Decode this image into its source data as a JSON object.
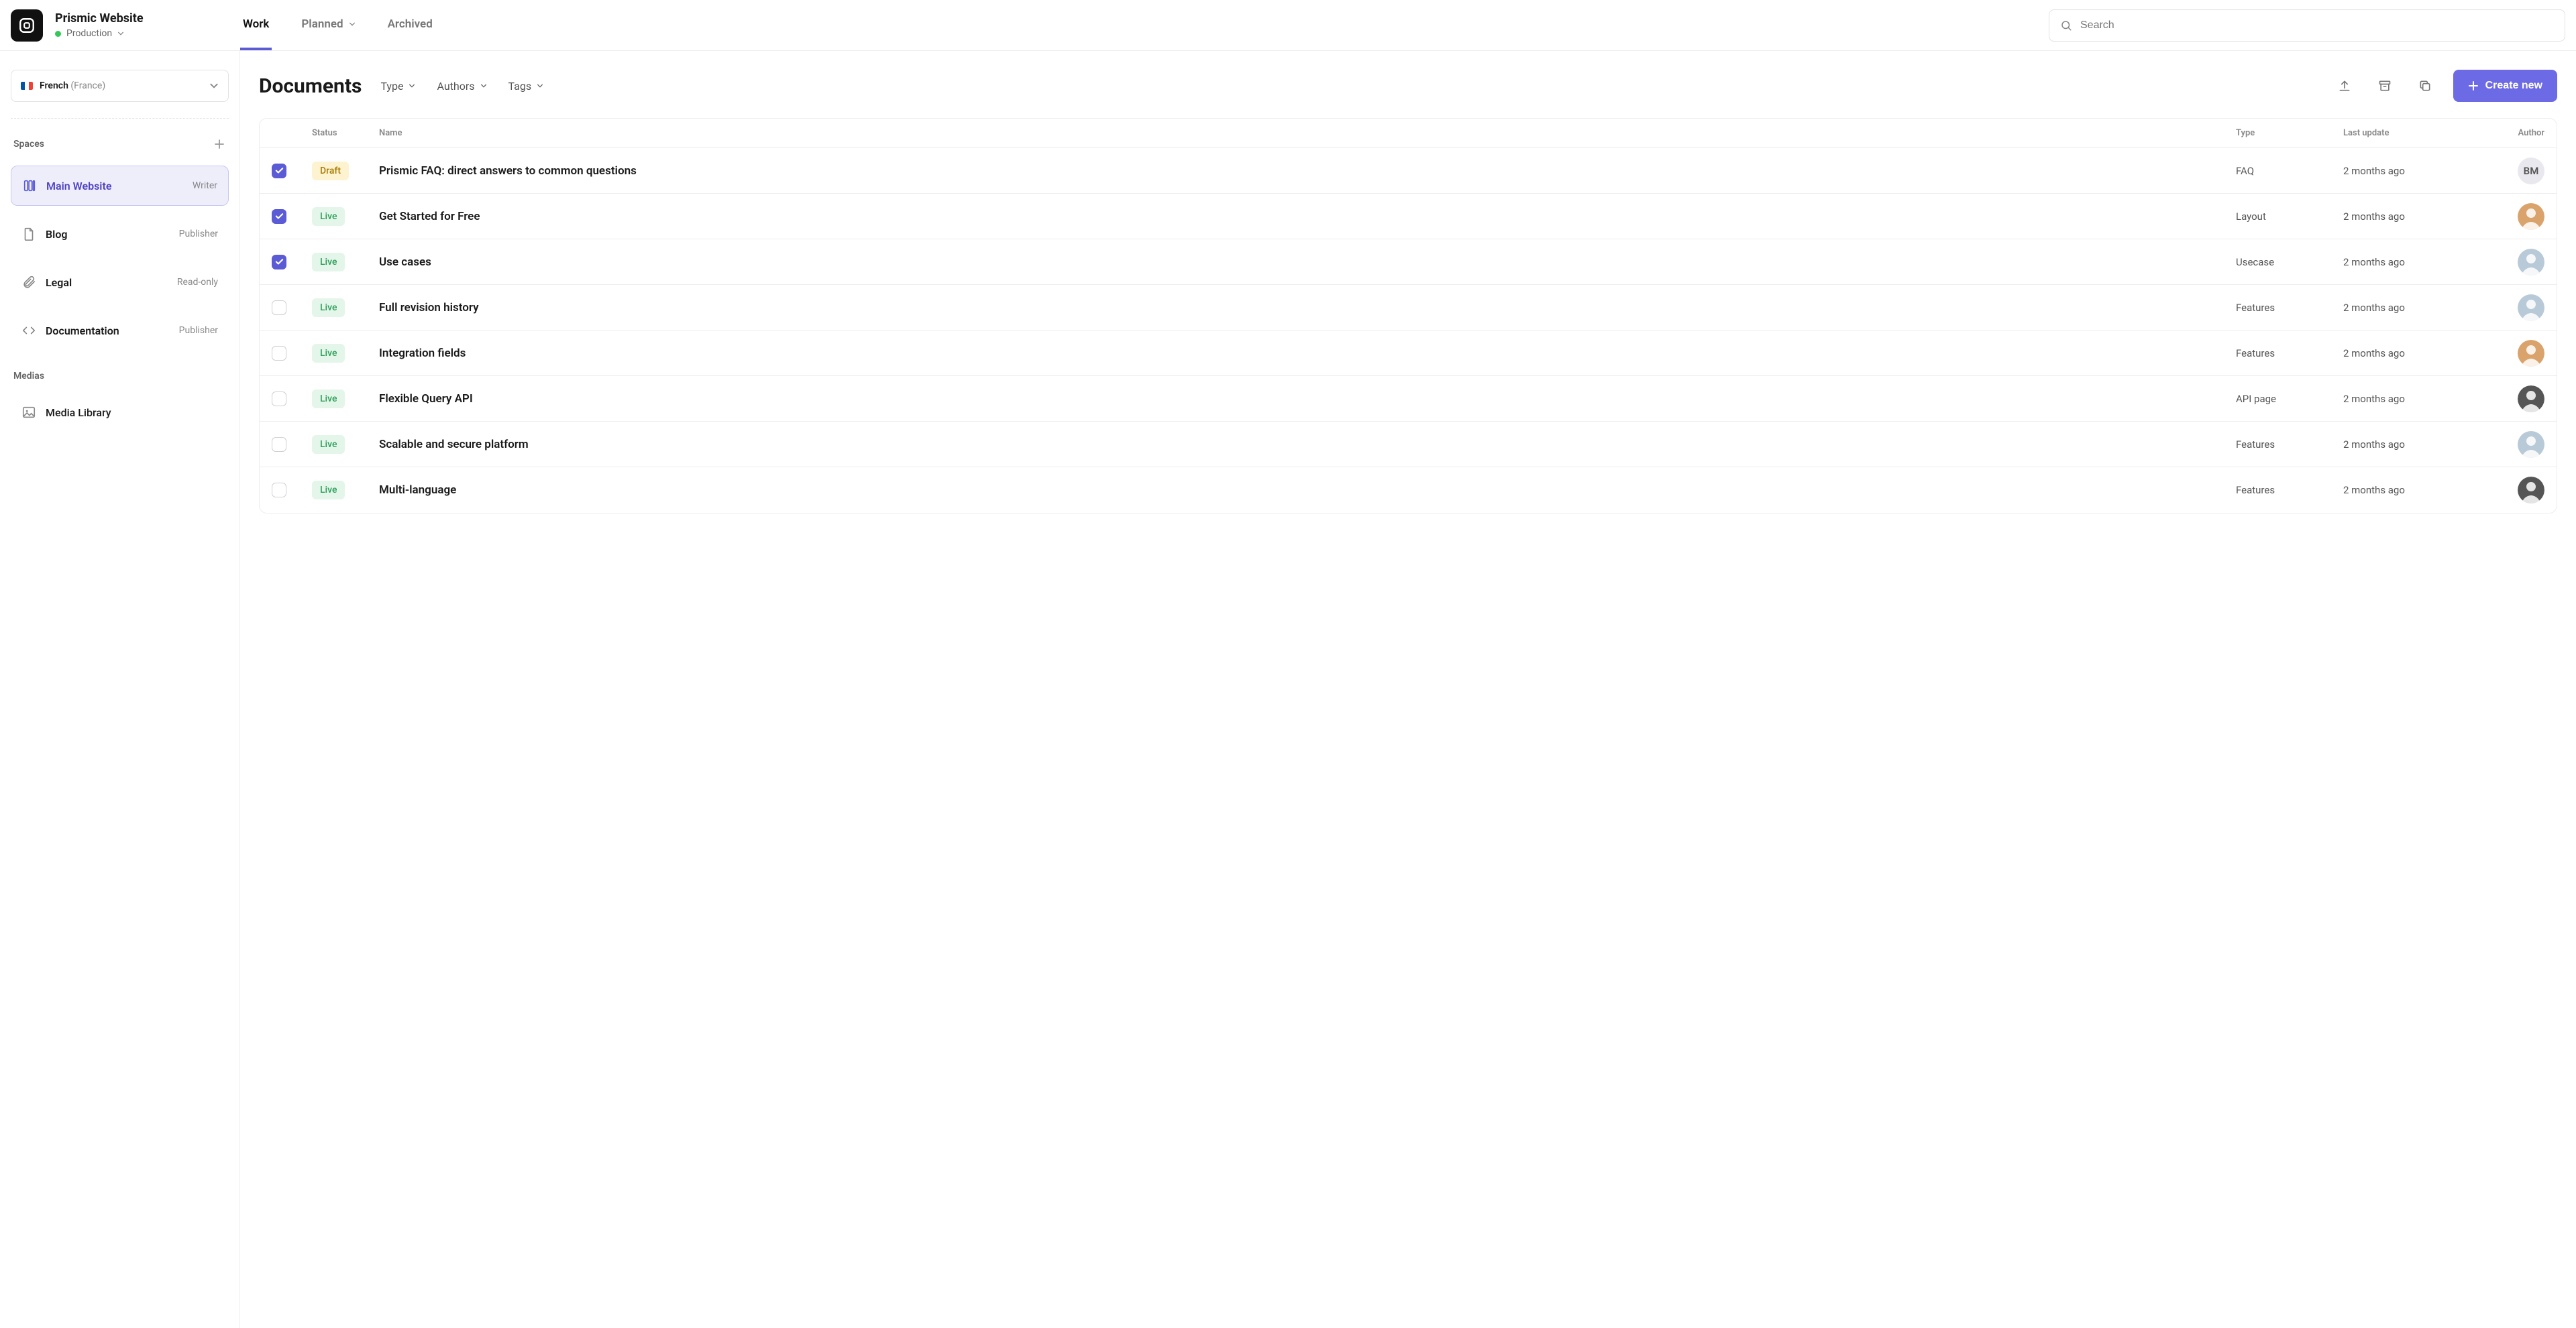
{
  "brand": {
    "title": "Prismic Website",
    "environment": "Production"
  },
  "nav": {
    "tabs": [
      {
        "label": "Work",
        "active": true
      },
      {
        "label": "Planned",
        "active": false,
        "has_chevron": true
      },
      {
        "label": "Archived",
        "active": false
      }
    ]
  },
  "search": {
    "placeholder": "Search"
  },
  "locale": {
    "language": "French",
    "region": "(France)"
  },
  "sidebar": {
    "spaces_label": "Spaces",
    "spaces": [
      {
        "name": "Main Website",
        "role": "Writer",
        "icon": "columns",
        "active": true
      },
      {
        "name": "Blog",
        "role": "Publisher",
        "icon": "page",
        "active": false
      },
      {
        "name": "Legal",
        "role": "Read-only",
        "icon": "clip",
        "active": false
      },
      {
        "name": "Documentation",
        "role": "Publisher",
        "icon": "code",
        "active": false
      }
    ],
    "medias_label": "Medias",
    "media_library_label": "Media Library"
  },
  "main": {
    "title": "Documents",
    "filters": [
      {
        "label": "Type"
      },
      {
        "label": "Authors"
      },
      {
        "label": "Tags"
      }
    ],
    "create_label": "Create new"
  },
  "table": {
    "headers": {
      "status": "Status",
      "name": "Name",
      "type": "Type",
      "last_update": "Last update",
      "author": "Author"
    },
    "rows": [
      {
        "checked": true,
        "status": "Draft",
        "name": "Prismic FAQ: direct answers to common questions",
        "type": "FAQ",
        "last_update": "2 months ago",
        "author_kind": "initials",
        "author": "BM"
      },
      {
        "checked": true,
        "status": "Live",
        "name": "Get Started for Free",
        "type": "Layout",
        "last_update": "2 months ago",
        "author_kind": "avatar",
        "author": "a1"
      },
      {
        "checked": true,
        "status": "Live",
        "name": "Use cases",
        "type": "Usecase",
        "last_update": "2 months ago",
        "author_kind": "avatar",
        "author": "a2"
      },
      {
        "checked": false,
        "status": "Live",
        "name": "Full revision history",
        "type": "Features",
        "last_update": "2 months ago",
        "author_kind": "avatar",
        "author": "a2"
      },
      {
        "checked": false,
        "status": "Live",
        "name": "Integration fields",
        "type": "Features",
        "last_update": "2 months ago",
        "author_kind": "avatar",
        "author": "a1"
      },
      {
        "checked": false,
        "status": "Live",
        "name": "Flexible Query API",
        "type": "API page",
        "last_update": "2 months ago",
        "author_kind": "avatar",
        "author": "a3"
      },
      {
        "checked": false,
        "status": "Live",
        "name": "Scalable and secure platform",
        "type": "Features",
        "last_update": "2 months ago",
        "author_kind": "avatar",
        "author": "a2"
      },
      {
        "checked": false,
        "status": "Live",
        "name": "Multi-language",
        "type": "Features",
        "last_update": "2 months ago",
        "author_kind": "avatar",
        "author": "a3"
      }
    ]
  }
}
